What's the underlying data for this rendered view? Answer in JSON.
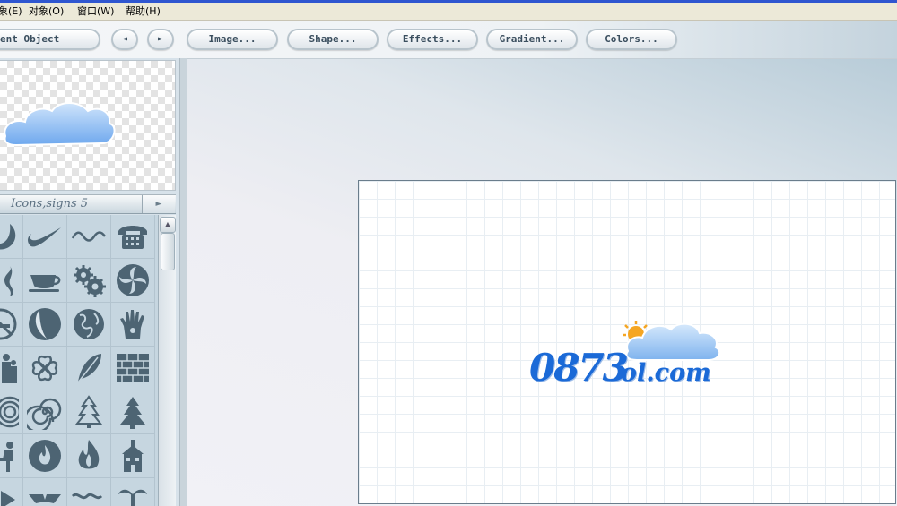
{
  "menu": {
    "items": [
      {
        "label": "象(E)"
      },
      {
        "label": "对象(O)"
      },
      {
        "label": "窗口(W)"
      },
      {
        "label": "帮助(H)"
      }
    ]
  },
  "toolbar": {
    "current_object_label": "ent Object",
    "prev_label": "◄",
    "next_label": "►",
    "image_label": "Image...",
    "shape_label": "Shape...",
    "effects_label": "Effects...",
    "gradient_label": "Gradient...",
    "colors_label": "Colors..."
  },
  "library": {
    "category": "Icons,signs 5",
    "expand_arrow": "►",
    "icons": [
      "swoosh-ring-icon",
      "nike-swoosh-icon",
      "wave-line-icon",
      "telephone-icon",
      "swirl-icon",
      "coffee-cup-icon",
      "gears-icon",
      "spiral-fan-icon",
      "no-smoking-icon",
      "yin-moon-icon",
      "earth-icon",
      "hand-print-icon",
      "people-icon",
      "clover-icon",
      "feather-icon",
      "brick-wall-icon",
      "spiral-rings-icon",
      "spiral-icon",
      "christmas-tree-outline-icon",
      "christmas-tree-icon",
      "person-sitting-icon",
      "fire-circle-icon",
      "fire-icon",
      "schoolhouse-icon",
      "arrow-partial-icon",
      "wing-emblem-icon",
      "squiggle-icon",
      "palm-tree-icon"
    ]
  },
  "canvas": {
    "logo_number": "0873",
    "logo_suffix": "ol.com"
  },
  "colors": {
    "icon": "#4d6473",
    "logo_blue": "#1b6ad7",
    "cloud_blue": "#8cbcf0",
    "sun": "#f5a623"
  }
}
